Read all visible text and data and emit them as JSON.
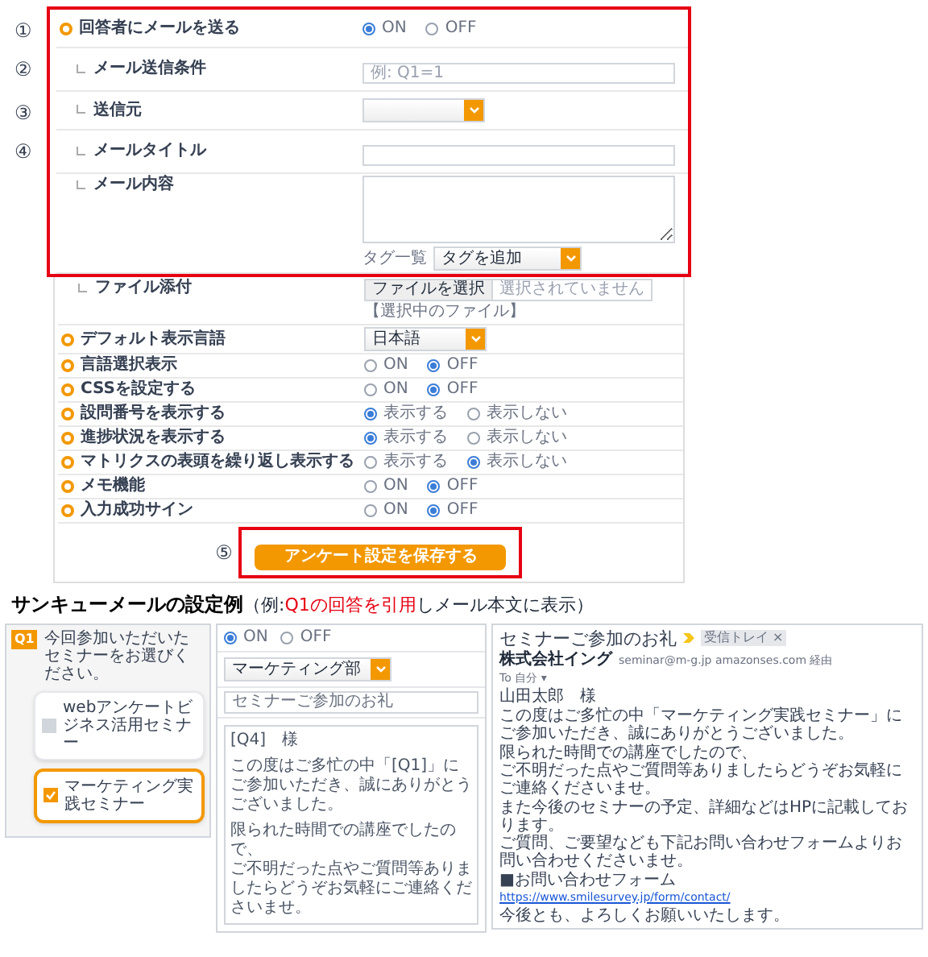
{
  "settings": [
    {
      "kind": "radio",
      "sub": false,
      "highlighted": true,
      "marker": "①",
      "label": "回答者にメールを送る",
      "options": [
        {
          "label": "ON",
          "selected": true
        },
        {
          "label": "OFF",
          "selected": false
        }
      ]
    },
    {
      "kind": "input",
      "sub": true,
      "highlighted": true,
      "marker": "②",
      "label": "メール送信条件",
      "placeholder": "例: Q1=1"
    },
    {
      "kind": "select",
      "sub": true,
      "highlighted": true,
      "marker": "③",
      "label": "送信元"
    },
    {
      "kind": "input",
      "sub": true,
      "highlighted": true,
      "marker": "④",
      "label": "メールタイトル"
    },
    {
      "kind": "textarea",
      "sub": true,
      "highlighted": true,
      "label": "メール内容",
      "tag_label": "タグ一覧",
      "tag_select": "タグを追加"
    },
    {
      "kind": "file",
      "sub": true,
      "highlighted": false,
      "label": "ファイル添付",
      "button": "ファイルを選択",
      "status": "選択されていません",
      "note": "【選択中のファイル】"
    },
    {
      "kind": "select",
      "sub": false,
      "highlighted": false,
      "label": "デフォルト表示言語",
      "value": "日本語"
    },
    {
      "kind": "radio",
      "sub": false,
      "highlighted": false,
      "label": "言語選択表示",
      "options": [
        {
          "label": "ON",
          "selected": false
        },
        {
          "label": "OFF",
          "selected": true
        }
      ]
    },
    {
      "kind": "radio",
      "sub": false,
      "highlighted": false,
      "label": "CSSを設定する",
      "options": [
        {
          "label": "ON",
          "selected": false
        },
        {
          "label": "OFF",
          "selected": true
        }
      ]
    },
    {
      "kind": "radio",
      "sub": false,
      "highlighted": false,
      "label": "設問番号を表示する",
      "options": [
        {
          "label": "表示する",
          "selected": true
        },
        {
          "label": "表示しない",
          "selected": false
        }
      ]
    },
    {
      "kind": "radio",
      "sub": false,
      "highlighted": false,
      "label": "進捗状況を表示する",
      "options": [
        {
          "label": "表示する",
          "selected": true
        },
        {
          "label": "表示しない",
          "selected": false
        }
      ]
    },
    {
      "kind": "radio",
      "sub": false,
      "highlighted": false,
      "label": "マトリクスの表頭を繰り返し表示する",
      "options": [
        {
          "label": "表示する",
          "selected": false
        },
        {
          "label": "表示しない",
          "selected": true
        }
      ]
    },
    {
      "kind": "radio",
      "sub": false,
      "highlighted": false,
      "label": "メモ機能",
      "options": [
        {
          "label": "ON",
          "selected": false
        },
        {
          "label": "OFF",
          "selected": true
        }
      ]
    },
    {
      "kind": "radio",
      "sub": false,
      "highlighted": false,
      "label": "入力成功サイン",
      "options": [
        {
          "label": "ON",
          "selected": false
        },
        {
          "label": "OFF",
          "selected": true
        }
      ]
    }
  ],
  "save_button": {
    "label": "アンケート設定を保存する",
    "marker": "⑤",
    "highlighted": true
  },
  "example": {
    "title": "サンキューメールの設定例",
    "caption": [
      {
        "text": "（例:",
        "highlight": false
      },
      {
        "text": "Q1の回答を引用",
        "highlight": true
      },
      {
        "text": "しメール本文に表示）",
        "highlight": false
      }
    ]
  },
  "survey_panel": {
    "question_number": "Q1",
    "question": "今回参加いただいたセミナーをお選びください。",
    "choices": [
      {
        "label": "webアンケートビジネス活用セミナー",
        "checked": false
      },
      {
        "label": "マーケティング実践セミナー",
        "checked": true
      }
    ]
  },
  "settings_panel": {
    "options": [
      {
        "label": "ON",
        "selected": true
      },
      {
        "label": "OFF",
        "selected": false
      }
    ],
    "department": "マーケティング部",
    "subject": "セミナーご参加のお礼",
    "body": [
      [
        "[Q4]　様"
      ],
      [
        "この度はご多忙の中「[Q1]」に",
        "ご参加いただき、誠にありがとうございました。"
      ],
      [
        "限られた時間での講座でしたので、",
        "ご不明だった点やご質問等ありましたらどうぞお気軽にご連絡くださいませ。"
      ]
    ]
  },
  "email_panel": {
    "subject": "セミナーご参加のお礼",
    "inbox_tag": "受信トレイ ×",
    "sender": "株式会社イング",
    "address": "seminar@m-g.jp amazonses.com 経由",
    "to": "To 自分 ▾",
    "body": [
      [
        "山田太郎　様"
      ],
      [
        "この度はご多忙の中「マーケティング実践セミナー」に",
        "ご参加いただき、誠にありがとうございました。"
      ],
      [
        "限られた時間での講座でしたので、",
        "ご不明だった点やご質問等ありましたらどうぞお気軽にご連絡くださいませ。"
      ],
      [
        "また今後のセミナーの予定、詳細などはHPに記載しております。",
        "ご質問、ご要望なども下記お問い合わせフォームよりお問い合わせくださいませ。"
      ],
      [
        "■お問い合わせフォーム"
      ]
    ],
    "link": "https://www.smilesurvey.jp/form/contact/",
    "closing": "今後とも、よろしくお願いいたします。"
  }
}
